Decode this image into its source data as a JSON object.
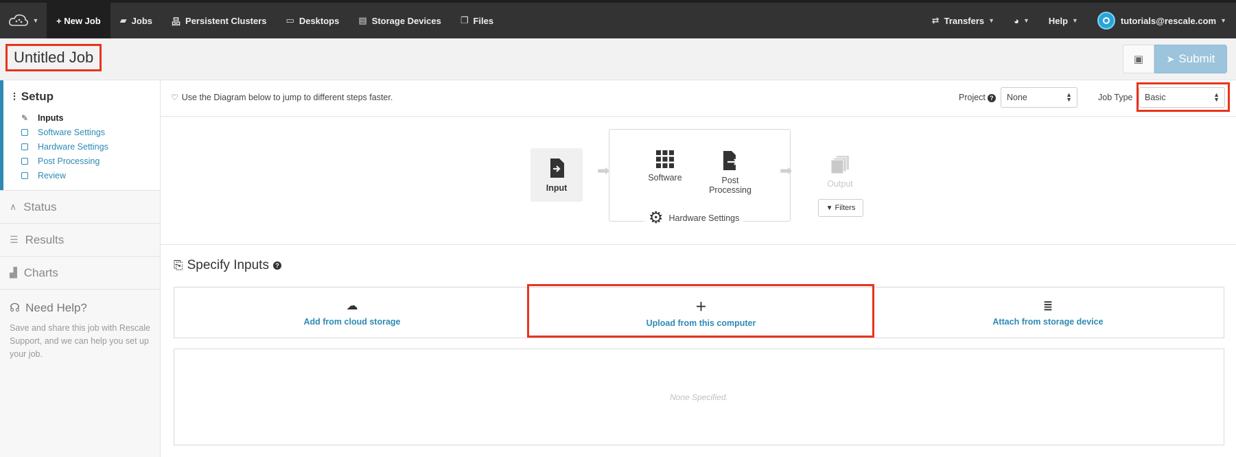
{
  "nav": {
    "items": [
      {
        "label": "+ New Job",
        "icon": "plus-icon"
      },
      {
        "label": "Jobs",
        "icon": "folder-icon"
      },
      {
        "label": "Persistent Clusters",
        "icon": "cluster-icon"
      },
      {
        "label": "Desktops",
        "icon": "desktop-icon"
      },
      {
        "label": "Storage Devices",
        "icon": "database-icon"
      },
      {
        "label": "Files",
        "icon": "files-icon"
      }
    ],
    "transfers": "Transfers",
    "help": "Help",
    "user": "tutorials@rescale.com"
  },
  "job": {
    "title": "Untitled Job",
    "submit_label": "Submit"
  },
  "sidebar": {
    "setup_label": "Setup",
    "steps": [
      "Inputs",
      "Software Settings",
      "Hardware Settings",
      "Post Processing",
      "Review"
    ],
    "status_label": "Status",
    "results_label": "Results",
    "charts_label": "Charts",
    "help_title": "Need Help?",
    "help_text": "Save and share this job with Rescale Support, and we can help you set up your job."
  },
  "infobar": {
    "tip": "Use the Diagram below to jump to different steps faster.",
    "project_label": "Project",
    "project_value": "None",
    "jobtype_label": "Job Type",
    "jobtype_value": "Basic"
  },
  "diagram": {
    "input": "Input",
    "software": "Software",
    "post_processing": "Post Processing",
    "hardware_settings": "Hardware Settings",
    "output": "Output",
    "filters": "Filters"
  },
  "inputs": {
    "title": "Specify Inputs",
    "sources": [
      "Add from cloud storage",
      "Upload from this computer",
      "Attach from storage device"
    ],
    "empty": "None Specified."
  },
  "colors": {
    "nav_bg": "#333333",
    "accent": "#2e8ab5",
    "highlight": "#e8341c",
    "submit_bg": "#9cc4dc"
  }
}
